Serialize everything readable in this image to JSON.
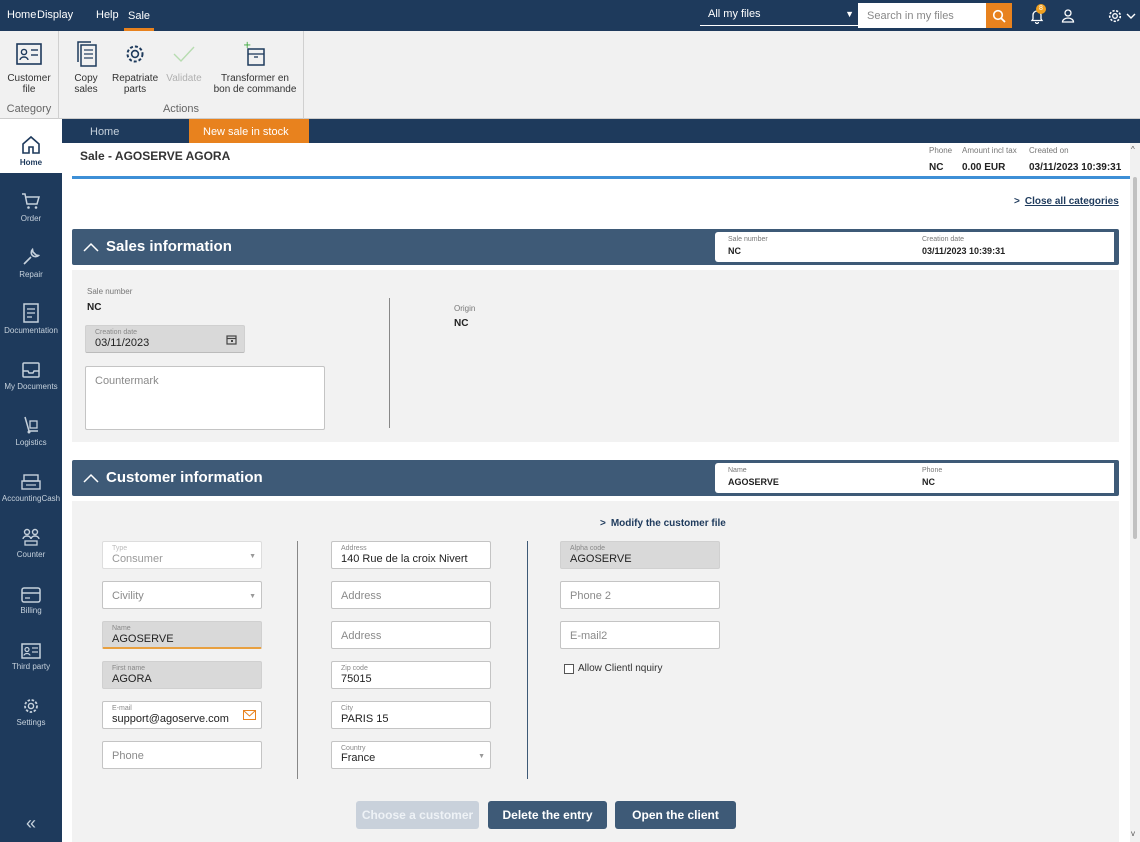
{
  "topbar": {
    "menus": [
      "Home",
      "Display",
      "Help",
      "Sale"
    ],
    "file_filter": "All my files",
    "search_placeholder": "Search in my files",
    "notification_count": "8"
  },
  "ribbon": {
    "customer_file": "Customer file",
    "category_group": "Category",
    "copy_sales": "Copy sales",
    "repatriate_parts": "Repatriate parts",
    "validate": "Validate",
    "transform": "Transformer en bon de commande",
    "actions_group": "Actions"
  },
  "sidebar": {
    "items": [
      "Home",
      "Order",
      "Repair",
      "Documentation",
      "My Documents",
      "Logistics",
      "AccountingCash",
      "Counter",
      "Billing",
      "Third party",
      "Settings"
    ],
    "collapse": "«"
  },
  "tabs": {
    "home": "Home",
    "new_sale": "New sale in stock",
    "close": "✕"
  },
  "header": {
    "title": "Sale - AGOSERVE AGORA",
    "phone_label": "Phone",
    "phone_value": "NC",
    "amount_label": "Amount incl tax",
    "amount_value": "0.00 EUR",
    "created_label": "Created on",
    "created_value": "03/11/2023 10:39:31"
  },
  "close_all": "Close all categories",
  "sales_info": {
    "title": "Sales information",
    "summary_sale_number_label": "Sale number",
    "summary_sale_number_value": "NC",
    "summary_creation_label": "Creation date",
    "summary_creation_value": "03/11/2023 10:39:31",
    "sale_number_label": "Sale number",
    "sale_number_value": "NC",
    "creation_date_label": "Creation date",
    "creation_date_value": "03/11/2023",
    "countermark_placeholder": "Countermark",
    "origin_label": "Origin",
    "origin_value": "NC"
  },
  "customer_info": {
    "title": "Customer information",
    "summary_name_label": "Name",
    "summary_name_value": "AGOSERVE",
    "summary_phone_label": "Phone",
    "summary_phone_value": "NC",
    "modify_link": "Modify the customer file",
    "type_label": "Type",
    "type_value": "Consumer",
    "civility_placeholder": "Civility",
    "name_label": "Name",
    "name_value": "AGOSERVE",
    "first_name_label": "First name",
    "first_name_value": "AGORA",
    "email_label": "E-mail",
    "email_value": "support@agoserve.com",
    "phone_placeholder": "Phone",
    "address_label": "Address",
    "address_value": "140 Rue de la croix Nivert",
    "address2_placeholder": "Address",
    "address3_placeholder": "Address",
    "zip_label": "Zip code",
    "zip_value": "75015",
    "city_label": "City",
    "city_value": "PARIS 15",
    "country_label": "Country",
    "country_value": "France",
    "alpha_label": "Alpha code",
    "alpha_value": "AGOSERVE",
    "phone2_placeholder": "Phone 2",
    "email2_placeholder": "E-mail2",
    "allow_inquiry": "Allow Clientl nquiry"
  },
  "buttons": {
    "choose_customer": "Choose a customer",
    "delete_entry": "Delete the entry",
    "open_client": "Open the client"
  },
  "colors": {
    "navy": "#1e3a5c",
    "section": "#3e5a77",
    "accent": "#e8821e"
  }
}
